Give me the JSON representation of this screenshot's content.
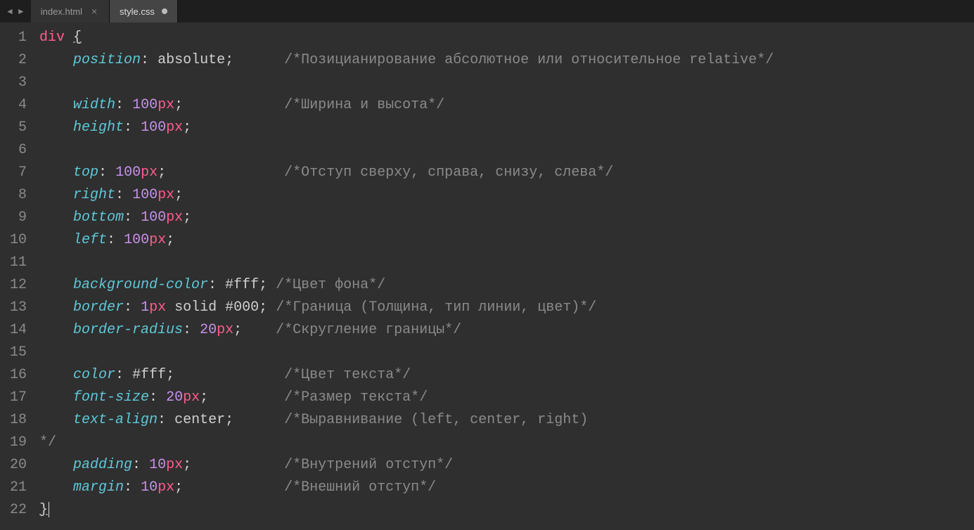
{
  "nav": {
    "back": "◄",
    "forward": "►"
  },
  "tabs": [
    {
      "label": "index.html",
      "active": false,
      "dirty": false
    },
    {
      "label": "style.css",
      "active": true,
      "dirty": true
    }
  ],
  "gutter_start": 1,
  "gutter_end": 22,
  "code": {
    "lines": [
      {
        "n": 1,
        "tokens": [
          [
            "sel",
            "div"
          ],
          [
            "sp",
            " "
          ],
          [
            "brace",
            "{"
          ]
        ]
      },
      {
        "n": 2,
        "tokens": [
          [
            "indent",
            "    "
          ],
          [
            "prop",
            "position"
          ],
          [
            "punct",
            ":"
          ],
          [
            "sp",
            " "
          ],
          [
            "val",
            "absolute"
          ],
          [
            "punct",
            ";"
          ],
          [
            "pad",
            "      "
          ],
          [
            "comm",
            "/*Позицианирование абсолютное или относительное relative*/"
          ]
        ]
      },
      {
        "n": 3,
        "tokens": []
      },
      {
        "n": 4,
        "tokens": [
          [
            "indent",
            "    "
          ],
          [
            "prop",
            "width"
          ],
          [
            "punct",
            ":"
          ],
          [
            "sp",
            " "
          ],
          [
            "num",
            "100"
          ],
          [
            "unit",
            "px"
          ],
          [
            "punct",
            ";"
          ],
          [
            "pad",
            "            "
          ],
          [
            "comm",
            "/*Ширина и высота*/"
          ]
        ]
      },
      {
        "n": 5,
        "tokens": [
          [
            "indent",
            "    "
          ],
          [
            "prop",
            "height"
          ],
          [
            "punct",
            ":"
          ],
          [
            "sp",
            " "
          ],
          [
            "num",
            "100"
          ],
          [
            "unit",
            "px"
          ],
          [
            "punct",
            ";"
          ]
        ]
      },
      {
        "n": 6,
        "tokens": []
      },
      {
        "n": 7,
        "tokens": [
          [
            "indent",
            "    "
          ],
          [
            "prop",
            "top"
          ],
          [
            "punct",
            ":"
          ],
          [
            "sp",
            " "
          ],
          [
            "num",
            "100"
          ],
          [
            "unit",
            "px"
          ],
          [
            "punct",
            ";"
          ],
          [
            "pad",
            "              "
          ],
          [
            "comm",
            "/*Отступ сверху, справа, снизу, слева*/"
          ]
        ]
      },
      {
        "n": 8,
        "tokens": [
          [
            "indent",
            "    "
          ],
          [
            "prop",
            "right"
          ],
          [
            "punct",
            ":"
          ],
          [
            "sp",
            " "
          ],
          [
            "num",
            "100"
          ],
          [
            "unit",
            "px"
          ],
          [
            "punct",
            ";"
          ]
        ]
      },
      {
        "n": 9,
        "tokens": [
          [
            "indent",
            "    "
          ],
          [
            "prop",
            "bottom"
          ],
          [
            "punct",
            ":"
          ],
          [
            "sp",
            " "
          ],
          [
            "num",
            "100"
          ],
          [
            "unit",
            "px"
          ],
          [
            "punct",
            ";"
          ]
        ]
      },
      {
        "n": 10,
        "tokens": [
          [
            "indent",
            "    "
          ],
          [
            "prop",
            "left"
          ],
          [
            "punct",
            ":"
          ],
          [
            "sp",
            " "
          ],
          [
            "num",
            "100"
          ],
          [
            "unit",
            "px"
          ],
          [
            "punct",
            ";"
          ]
        ]
      },
      {
        "n": 11,
        "tokens": []
      },
      {
        "n": 12,
        "tokens": [
          [
            "indent",
            "    "
          ],
          [
            "prop",
            "background-color"
          ],
          [
            "punct",
            ":"
          ],
          [
            "sp",
            " "
          ],
          [
            "hex",
            "#fff"
          ],
          [
            "punct",
            ";"
          ],
          [
            "sp",
            " "
          ],
          [
            "comm",
            "/*Цвет фона*/"
          ]
        ]
      },
      {
        "n": 13,
        "tokens": [
          [
            "indent",
            "    "
          ],
          [
            "prop",
            "border"
          ],
          [
            "punct",
            ":"
          ],
          [
            "sp",
            " "
          ],
          [
            "num",
            "1"
          ],
          [
            "unit",
            "px"
          ],
          [
            "sp",
            " "
          ],
          [
            "val",
            "solid"
          ],
          [
            "sp",
            " "
          ],
          [
            "hex",
            "#000"
          ],
          [
            "punct",
            ";"
          ],
          [
            "sp",
            " "
          ],
          [
            "comm",
            "/*Граница (Толщина, тип линии, цвет)*/"
          ]
        ]
      },
      {
        "n": 14,
        "tokens": [
          [
            "indent",
            "    "
          ],
          [
            "prop",
            "border-radius"
          ],
          [
            "punct",
            ":"
          ],
          [
            "sp",
            " "
          ],
          [
            "num",
            "20"
          ],
          [
            "unit",
            "px"
          ],
          [
            "punct",
            ";"
          ],
          [
            "pad",
            "    "
          ],
          [
            "comm",
            "/*Скругление границы*/"
          ]
        ]
      },
      {
        "n": 15,
        "tokens": []
      },
      {
        "n": 16,
        "tokens": [
          [
            "indent",
            "    "
          ],
          [
            "prop",
            "color"
          ],
          [
            "punct",
            ":"
          ],
          [
            "sp",
            " "
          ],
          [
            "hex",
            "#fff"
          ],
          [
            "punct",
            ";"
          ],
          [
            "pad",
            "             "
          ],
          [
            "comm",
            "/*Цвет текста*/"
          ]
        ]
      },
      {
        "n": 17,
        "tokens": [
          [
            "indent",
            "    "
          ],
          [
            "prop",
            "font-size"
          ],
          [
            "punct",
            ":"
          ],
          [
            "sp",
            " "
          ],
          [
            "num",
            "20"
          ],
          [
            "unit",
            "px"
          ],
          [
            "punct",
            ";"
          ],
          [
            "pad",
            "         "
          ],
          [
            "comm",
            "/*Размер текста*/"
          ]
        ]
      },
      {
        "n": 18,
        "tokens": [
          [
            "indent",
            "    "
          ],
          [
            "prop",
            "text-align"
          ],
          [
            "punct",
            ":"
          ],
          [
            "sp",
            " "
          ],
          [
            "val",
            "center"
          ],
          [
            "punct",
            ";"
          ],
          [
            "pad",
            "      "
          ],
          [
            "comm",
            "/*Выравнивание (left, center, right)"
          ]
        ]
      },
      {
        "n": 19,
        "tokens": [
          [
            "comm",
            "*/"
          ]
        ]
      },
      {
        "n": 20,
        "tokens": [
          [
            "indent",
            "    "
          ],
          [
            "prop",
            "padding"
          ],
          [
            "punct",
            ":"
          ],
          [
            "sp",
            " "
          ],
          [
            "num",
            "10"
          ],
          [
            "unit",
            "px"
          ],
          [
            "punct",
            ";"
          ],
          [
            "pad",
            "           "
          ],
          [
            "comm",
            "/*Внутрений отступ*/"
          ]
        ]
      },
      {
        "n": 21,
        "tokens": [
          [
            "indent",
            "    "
          ],
          [
            "prop",
            "margin"
          ],
          [
            "punct",
            ":"
          ],
          [
            "sp",
            " "
          ],
          [
            "num",
            "10"
          ],
          [
            "unit",
            "px"
          ],
          [
            "punct",
            ";"
          ],
          [
            "pad",
            "            "
          ],
          [
            "comm",
            "/*Внешний отступ*/"
          ]
        ]
      },
      {
        "n": 22,
        "tokens": [
          [
            "brace",
            "}"
          ],
          [
            "cursor",
            ""
          ]
        ]
      }
    ]
  }
}
